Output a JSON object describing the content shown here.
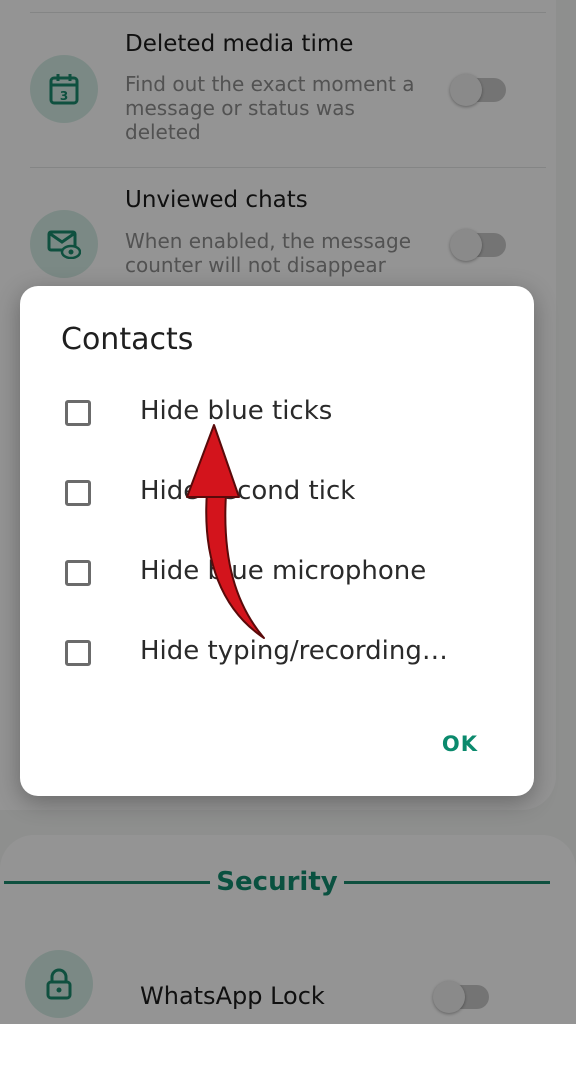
{
  "settings": {
    "rows": [
      {
        "title": "Deleted media time",
        "description": "Find out the exact moment a message or status was deleted",
        "icon": "calendar-icon",
        "icon_text": "3"
      },
      {
        "title": "Unviewed chats",
        "description": "When enabled, the message counter will not disappear",
        "icon": "mail-eye-icon"
      }
    ],
    "section_title": "Security",
    "security_rows": [
      {
        "title": "WhatsApp Lock",
        "icon": "lock-icon"
      }
    ]
  },
  "dialog": {
    "title": "Contacts",
    "options": [
      {
        "label": "Hide blue ticks",
        "checked": false
      },
      {
        "label": "Hide second tick",
        "checked": false
      },
      {
        "label": "Hide blue microphone",
        "checked": false
      },
      {
        "label": "Hide typing/recording…",
        "checked": false
      }
    ],
    "ok_label": "OK"
  },
  "colors": {
    "accent": "#128c6e",
    "annotation_arrow": "#d3141c"
  }
}
